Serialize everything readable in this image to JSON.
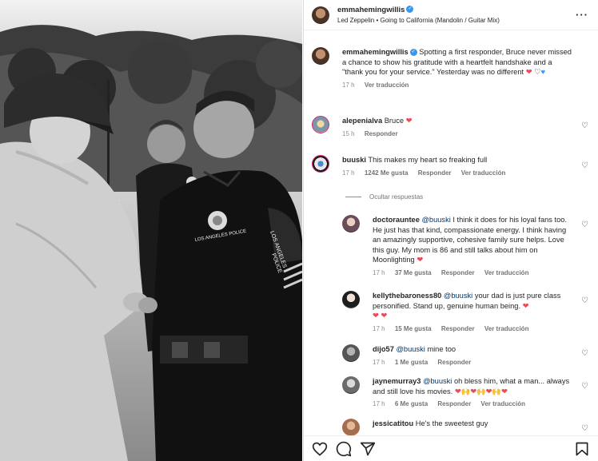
{
  "post": {
    "username": "emmahemingwillis",
    "song": "Led Zeppelin • Going to California (Mandolin / Guitar Mix)",
    "more_icon": "more-options-icon"
  },
  "caption": {
    "username": "emmahemingwillis",
    "text": "Spotting a first responder, Bruce never missed a chance to show his gratitude with a heartfelt handshake and a \"thank you for your service.\" Yesterday was no different",
    "emoji": "❤",
    "emoji2": "♡",
    "emoji3": "♥",
    "time": "17 h",
    "translate": "Ver traducción"
  },
  "comments": [
    {
      "username": "alepenialva",
      "text": "Bruce",
      "emoji": "❤",
      "time": "15 h",
      "reply": "Responder"
    },
    {
      "username": "buuski",
      "text": "This makes my heart so freaking full",
      "time": "17 h",
      "likes": "1242 Me gusta",
      "reply": "Responder",
      "translate": "Ver traducción"
    }
  ],
  "hide_replies": "Ocultar respuestas",
  "replies": [
    {
      "username": "doctorauntee",
      "mention": "@buuski",
      "text": "I think it does for his loyal fans too. He just has that kind, compassionate energy. I think having an amazingly supportive, cohesive family sure helps. Love this guy. My mom is 86 and still talks about him on Moonlighting",
      "emoji": "❤",
      "time": "17 h",
      "likes": "37 Me gusta",
      "reply": "Responder",
      "translate": "Ver traducción"
    },
    {
      "username": "kellythebaroness80",
      "mention": "@buuski",
      "text": "your dad is just pure class personified. Stand up, genuine human being.",
      "emoji": "❤",
      "emoji_line": "❤ ❤",
      "time": "17 h",
      "likes": "15 Me gusta",
      "reply": "Responder",
      "translate": "Ver traducción"
    },
    {
      "username": "dijo57",
      "mention": "@buuski",
      "text": "mine too",
      "time": "17 h",
      "likes": "1 Me gusta",
      "reply": "Responder"
    },
    {
      "username": "jaynemurray3",
      "mention": "@buuski",
      "text": "oh bless him, what a man... always and still love his movies.",
      "emoji": "❤🙌❤🙌❤🙌❤",
      "time": "17 h",
      "likes": "6 Me gusta",
      "reply": "Responder",
      "translate": "Ver traducción"
    },
    {
      "username": "jessicatitou",
      "text": "He's the sweetest guy"
    }
  ],
  "photo_text": {
    "patch_top": "LOS ANGELES",
    "patch_bottom": "POLICE",
    "badge": "LOS ANGELES POLICE"
  },
  "icons": {
    "like": "heart-icon",
    "comment": "comment-icon",
    "share": "share-icon",
    "save": "bookmark-icon"
  }
}
